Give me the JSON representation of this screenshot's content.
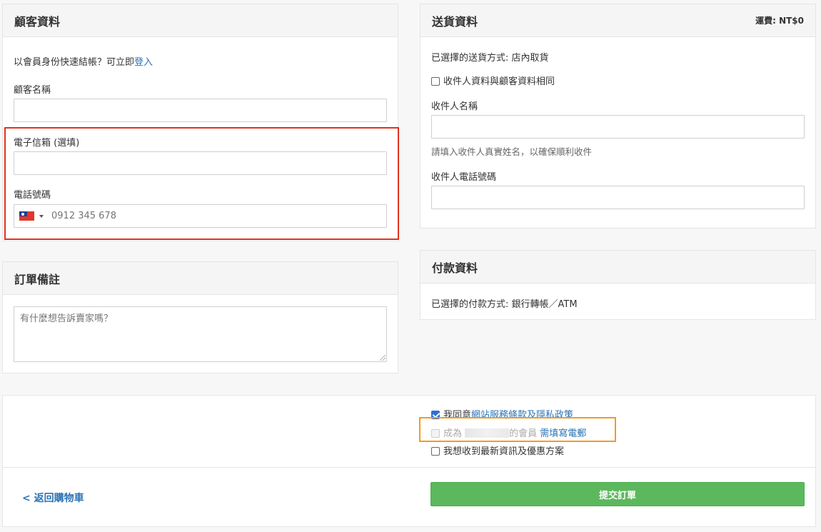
{
  "customer": {
    "title": "顧客資料",
    "member_prompt": "以會員身份快速結帳？可立即",
    "login_link": "登入",
    "name_label": "顧客名稱",
    "name_value": "",
    "email_label": "電子信箱 (選填)",
    "email_value": "",
    "phone_label": "電話號碼",
    "phone_placeholder": "0912 345 678",
    "phone_country_flag": "taiwan-flag-icon"
  },
  "order_note": {
    "title": "訂單備註",
    "placeholder": "有什麼想告訴賣家嗎？"
  },
  "shipping": {
    "title": "送貨資料",
    "fee": "運費: NT$0",
    "method": "已選擇的送貨方式: 店內取貨",
    "same_as_customer": "收件人資料與顧客資料相同",
    "same_as_customer_checked": false,
    "recipient_name_label": "收件人名稱",
    "recipient_name_help": "請填入收件人真實姓名，以確保順利收件",
    "recipient_phone_label": "收件人電話號碼"
  },
  "payment": {
    "title": "付款資料",
    "method": "已選擇的付款方式: 銀行轉帳／ATM"
  },
  "agreements": {
    "agree_prefix": "我同意",
    "agree_link": "網站服務條款及隱私政策",
    "agree_checked": true,
    "member_prefix": "成為 ",
    "member_suffix": "的會員",
    "member_link": "需填寫電郵",
    "member_checked": false,
    "member_disabled": true,
    "newsletter": "我想收到最新資訊及優惠方案",
    "newsletter_checked": false
  },
  "footer": {
    "back_link": "< 返回購物車",
    "submit": "提交訂單"
  },
  "colors": {
    "highlight_red": "#e0321e",
    "highlight_orange": "#f39a22",
    "submit_green": "#5cb85c",
    "link_blue": "#2b73b6"
  }
}
